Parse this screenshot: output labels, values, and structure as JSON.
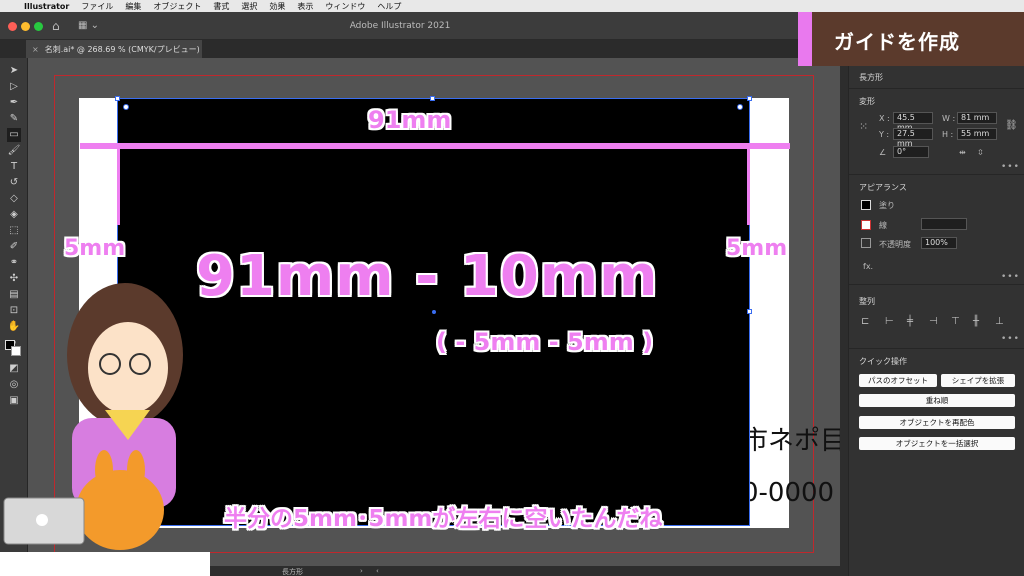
{
  "menubar": {
    "apple": "",
    "app_name": "Illustrator",
    "items": [
      "ファイル",
      "編集",
      "オブジェクト",
      "書式",
      "選択",
      "効果",
      "表示",
      "ウィンドウ",
      "ヘルプ"
    ]
  },
  "window": {
    "title": "Adobe Illustrator 2021",
    "home_icon": "⌂",
    "workspace_icon": "▦ ⌄"
  },
  "document_tab": {
    "close": "×",
    "label": "名刺.ai* @ 268.69 % (CMYK/プレビュー)"
  },
  "canvas": {
    "bg_text_1": "市ネポ目",
    "bg_text_2": "0-0000"
  },
  "annotations": {
    "top_width": "91mm",
    "left_margin": "5mm",
    "right_margin": "5mm",
    "formula": "91mm - 10mm",
    "formula_sub": "( - 5mm - 5mm )",
    "caption": "半分の5mm･5mmが左右に空いたんだね"
  },
  "badge": {
    "title": "ガイドを作成"
  },
  "panel": {
    "shape_label": "長方形",
    "transform": {
      "heading": "変形",
      "x_label": "X :",
      "x_value": "45.5 mm",
      "y_label": "Y :",
      "y_value": "27.5 mm",
      "w_label": "W :",
      "w_value": "81 mm",
      "h_label": "H :",
      "h_value": "55 mm",
      "angle_value": "0°"
    },
    "appearance": {
      "heading": "アピアランス",
      "fill_label": "塗り",
      "stroke_label": "線",
      "opacity_label": "不透明度",
      "opacity_value": "100%",
      "fx_label": "fx."
    },
    "align": {
      "heading": "整列"
    },
    "quick_actions": {
      "heading": "クイック操作",
      "offset_path": "パスのオフセット",
      "expand_shape": "シェイプを拡張",
      "arrange": "重ね順",
      "recolor": "オブジェクトを再配色",
      "select_same": "オブジェクトを一括選択"
    }
  },
  "statusbar": {
    "shape_label": "長方形"
  },
  "colors": {
    "accent_pink": "#ee7ff0",
    "selection_blue": "#3a6df0",
    "bleed_red": "#c0282d",
    "badge_brown": "#5b3a2c"
  }
}
